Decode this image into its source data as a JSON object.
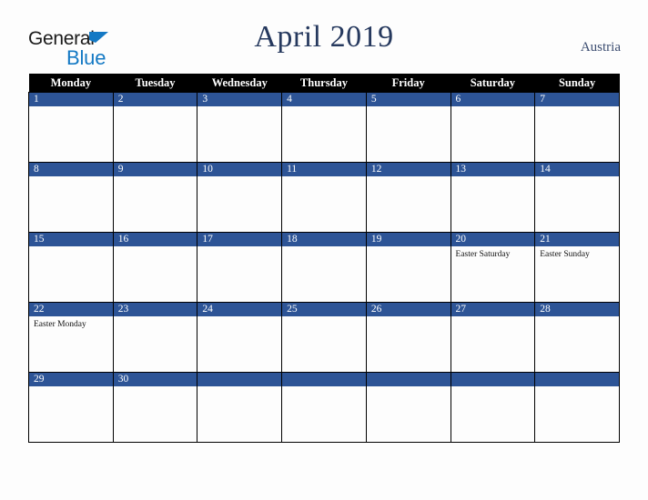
{
  "brand": {
    "name_part1": "General",
    "name_part2": "Blue",
    "triangle_icon": "triangle-icon",
    "color_black": "#1a1a1a",
    "color_blue": "#1479c4"
  },
  "header": {
    "title": "April 2019",
    "country": "Austria",
    "title_color": "#26395e",
    "country_color": "#3b4c70"
  },
  "calendar": {
    "month": "April",
    "year": "2019",
    "weekday_headers": [
      "Monday",
      "Tuesday",
      "Wednesday",
      "Thursday",
      "Friday",
      "Saturday",
      "Sunday"
    ],
    "header_bg": "#000000",
    "date_bar_bg": "#2d5496",
    "cell_bg": "#fdfdfd",
    "weeks": [
      [
        {
          "date": "1",
          "events": []
        },
        {
          "date": "2",
          "events": []
        },
        {
          "date": "3",
          "events": []
        },
        {
          "date": "4",
          "events": []
        },
        {
          "date": "5",
          "events": []
        },
        {
          "date": "6",
          "events": []
        },
        {
          "date": "7",
          "events": []
        }
      ],
      [
        {
          "date": "8",
          "events": []
        },
        {
          "date": "9",
          "events": []
        },
        {
          "date": "10",
          "events": []
        },
        {
          "date": "11",
          "events": []
        },
        {
          "date": "12",
          "events": []
        },
        {
          "date": "13",
          "events": []
        },
        {
          "date": "14",
          "events": []
        }
      ],
      [
        {
          "date": "15",
          "events": []
        },
        {
          "date": "16",
          "events": []
        },
        {
          "date": "17",
          "events": []
        },
        {
          "date": "18",
          "events": []
        },
        {
          "date": "19",
          "events": []
        },
        {
          "date": "20",
          "events": [
            "Easter Saturday"
          ]
        },
        {
          "date": "21",
          "events": [
            "Easter Sunday"
          ]
        }
      ],
      [
        {
          "date": "22",
          "events": [
            "Easter Monday"
          ]
        },
        {
          "date": "23",
          "events": []
        },
        {
          "date": "24",
          "events": []
        },
        {
          "date": "25",
          "events": []
        },
        {
          "date": "26",
          "events": []
        },
        {
          "date": "27",
          "events": []
        },
        {
          "date": "28",
          "events": []
        }
      ],
      [
        {
          "date": "29",
          "events": []
        },
        {
          "date": "30",
          "events": []
        },
        {
          "date": "",
          "events": []
        },
        {
          "date": "",
          "events": []
        },
        {
          "date": "",
          "events": []
        },
        {
          "date": "",
          "events": []
        },
        {
          "date": "",
          "events": []
        }
      ]
    ]
  }
}
